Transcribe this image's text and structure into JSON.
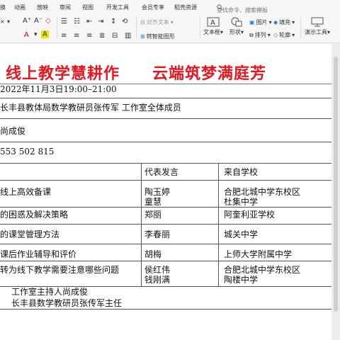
{
  "menubar": {
    "items": [
      "换",
      "动画",
      "放映",
      "审阅",
      "视图",
      "开发工具",
      "会员专享",
      "稻壳资源"
    ],
    "search_placeholder": "查找命令、搜索模板"
  },
  "toolbar": {
    "font_size_small": "A",
    "align_text": "对齐文本",
    "smart_graphic": "转智能图形",
    "textbox": "文本框",
    "shape": "形状",
    "picture": "图片",
    "arrange": "排列",
    "fill": "填充",
    "outline": "轮廓",
    "presenter_tools": "演示工具"
  },
  "slide": {
    "title": "线上教学慧耕作　　云端筑梦满庭芳",
    "time": "2022年11月3日19:00–21:00",
    "participants": "长丰县教体局数学教研员张传军 工作室全体成员",
    "host": "尚成俊",
    "meeting_id": "553 502 815",
    "table": {
      "headers": [
        "",
        "代表发言",
        "来自学校"
      ],
      "rows": [
        {
          "topic": "线上高效备课",
          "speakers": [
            "陶玉婷",
            "童慧"
          ],
          "schools": [
            "合肥北城中学东校区",
            "杜集中学"
          ]
        },
        {
          "topic": "的困惑及解决策略",
          "speakers": [
            "郑丽"
          ],
          "schools": [
            "阿奎利亚学校"
          ]
        },
        {
          "topic": "的课堂管理方法",
          "speakers": [
            "李春丽"
          ],
          "schools": [
            "城关中学"
          ]
        },
        {
          "topic": "课后作业辅导和评价",
          "speakers": [
            "胡梅"
          ],
          "schools": [
            "上师大学附属中学"
          ]
        },
        {
          "topic": "转为线下教学需要注意哪些问题",
          "speakers": [
            "侯红伟",
            "钱刚满"
          ],
          "schools": [
            "合肥北城中学东校区",
            "陶楼中学"
          ]
        }
      ]
    },
    "closing": [
      "工作室主持人尚成俊",
      "长丰县数学教研员张传军主任"
    ]
  },
  "colors": {
    "title_red": "#e6161f",
    "toolbar_bg": "#f6f6f6"
  }
}
